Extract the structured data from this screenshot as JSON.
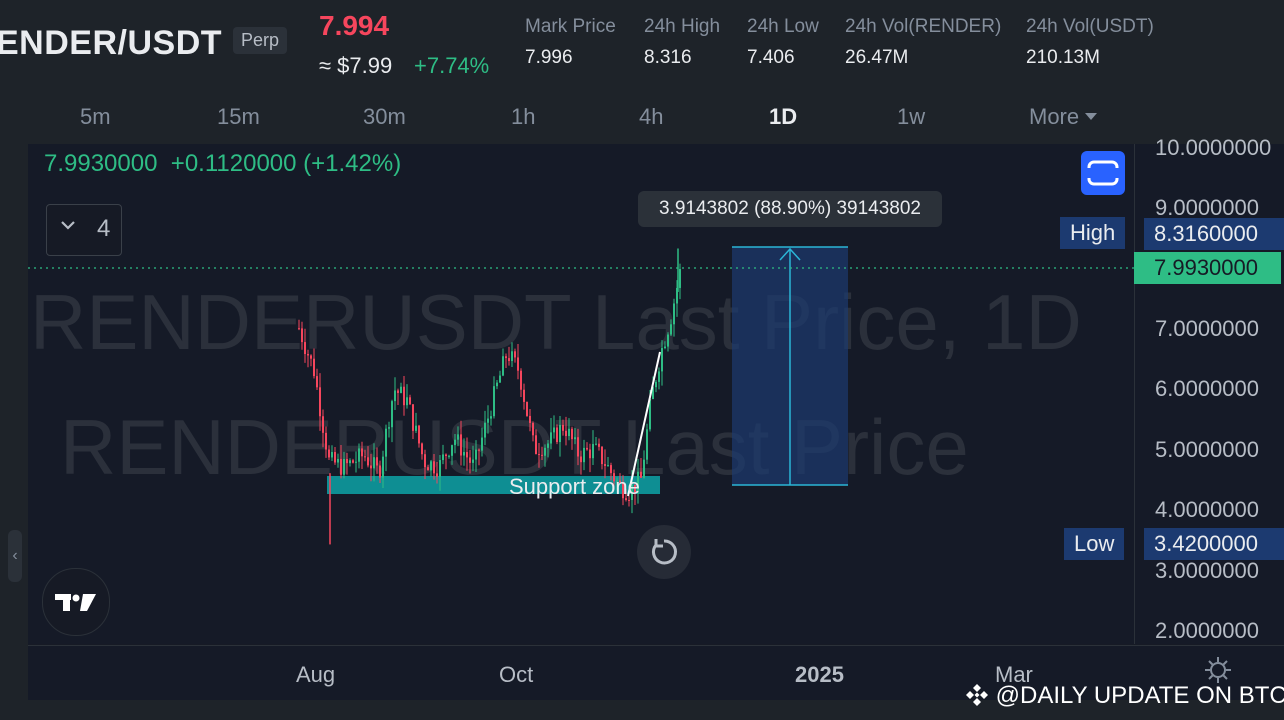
{
  "header": {
    "pair": "ENDER/USDT",
    "badge": "Perp",
    "last_price": "7.994",
    "approx_price": "≈ $7.99",
    "change_pct": "+7.74%",
    "stats": [
      {
        "label": "Mark Price",
        "value": "7.996"
      },
      {
        "label": "24h High",
        "value": "8.316"
      },
      {
        "label": "24h Low",
        "value": "7.406"
      },
      {
        "label": "24h Vol(RENDER)",
        "value": "26.47M"
      },
      {
        "label": "24h Vol(USDT)",
        "value": "210.13M"
      }
    ]
  },
  "timeframes": {
    "items": [
      "5m",
      "15m",
      "30m",
      "1h",
      "4h",
      "1D",
      "1w",
      "More"
    ],
    "active": "1D"
  },
  "chart": {
    "ohlc_close": "7.9930000",
    "ohlc_change": "+0.1120000 (+1.42%)",
    "indicator_count": "4",
    "watermark_line1": "RENDERUSDT Last Price, 1D",
    "watermark_line2": "RENDERUSDT Last Price",
    "measure_tooltip": "3.9143802 (88.90%) 39143802",
    "high_label": "High",
    "high_value": "8.3160000",
    "low_label": "Low",
    "low_value": "3.4200000",
    "last_value": "7.9930000",
    "support_label": "Support zone",
    "price_axis": [
      "10.0000000",
      "9.0000000",
      "7.0000000",
      "6.0000000",
      "5.0000000",
      "4.0000000",
      "3.0000000",
      "2.0000000"
    ],
    "time_axis": [
      "Aug",
      "Oct",
      "2025",
      "Mar"
    ]
  },
  "colors": {
    "up": "#2ebd85",
    "down": "#f6465d",
    "accent": "#2962ff",
    "measure_fill": "#1c3a70",
    "measure_line": "#2bb5d6",
    "support": "#0e8e93"
  },
  "footer": {
    "watermark": "@DAILY UPDATE ON BTC"
  }
}
